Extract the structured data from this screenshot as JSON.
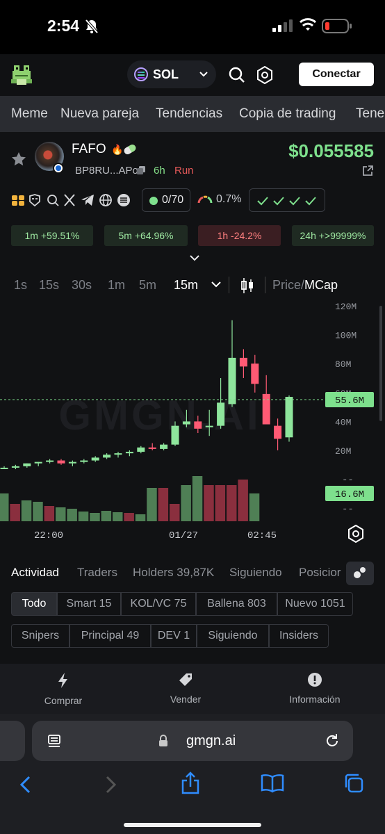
{
  "status": {
    "time": "2:54"
  },
  "header": {
    "chain": "SOL",
    "connect_label": "Conectar"
  },
  "nav_tabs": [
    "Meme",
    "Nueva pareja",
    "Tendencias",
    "Copia de trading",
    "Tene"
  ],
  "token": {
    "name": "FAFO",
    "address": "BP8RU...APo",
    "age": "6h",
    "run_label": "Run",
    "price": "$0.055585"
  },
  "metrics": {
    "holders_ratio": "0/70",
    "gauge_pct": "0.7%"
  },
  "changes": [
    {
      "period": "1m",
      "value": "+59.51%",
      "dir": "up"
    },
    {
      "period": "5m",
      "value": "+64.96%",
      "dir": "up"
    },
    {
      "period": "1h",
      "value": "-24.2%",
      "dir": "down"
    },
    {
      "period": "24h",
      "value": "+>99999%",
      "dir": "up"
    }
  ],
  "timeframes": [
    "1s",
    "15s",
    "30s",
    "1m",
    "5m",
    "15m"
  ],
  "active_timeframe": "15m",
  "price_label": "Price/",
  "mcap_label": "MCap",
  "chart_data": {
    "type": "candlestick",
    "watermark": "GMGN.AI",
    "y_ticks": [
      "120M",
      "100M",
      "80M",
      "60M",
      "40M",
      "20M"
    ],
    "x_ticks": [
      "22:00",
      "01/27",
      "02:45"
    ],
    "current_mcap": "55.6M",
    "current_volume": "16.6M",
    "candles": [
      {
        "o": 8,
        "h": 9,
        "l": 7,
        "c": 8
      },
      {
        "o": 8,
        "h": 10,
        "l": 7,
        "c": 9
      },
      {
        "o": 9,
        "h": 11,
        "l": 8,
        "c": 11
      },
      {
        "o": 11,
        "h": 12,
        "l": 9,
        "c": 12
      },
      {
        "o": 12,
        "h": 14,
        "l": 11,
        "c": 13
      },
      {
        "o": 13,
        "h": 14,
        "l": 10,
        "c": 11
      },
      {
        "o": 11,
        "h": 13,
        "l": 9,
        "c": 12
      },
      {
        "o": 12,
        "h": 14,
        "l": 11,
        "c": 13
      },
      {
        "o": 13,
        "h": 16,
        "l": 12,
        "c": 15
      },
      {
        "o": 15,
        "h": 18,
        "l": 14,
        "c": 17
      },
      {
        "o": 17,
        "h": 19,
        "l": 15,
        "c": 18
      },
      {
        "o": 18,
        "h": 20,
        "l": 16,
        "c": 19
      },
      {
        "o": 19,
        "h": 23,
        "l": 18,
        "c": 22
      },
      {
        "o": 22,
        "h": 25,
        "l": 20,
        "c": 21
      },
      {
        "o": 21,
        "h": 25,
        "l": 20,
        "c": 24
      },
      {
        "o": 24,
        "h": 40,
        "l": 23,
        "c": 37
      },
      {
        "o": 38,
        "h": 48,
        "l": 36,
        "c": 40
      },
      {
        "o": 40,
        "h": 44,
        "l": 32,
        "c": 35
      },
      {
        "o": 36,
        "h": 48,
        "l": 30,
        "c": 37
      },
      {
        "o": 37,
        "h": 70,
        "l": 35,
        "c": 53
      },
      {
        "o": 52,
        "h": 110,
        "l": 50,
        "c": 84
      },
      {
        "o": 84,
        "h": 90,
        "l": 70,
        "c": 78
      },
      {
        "o": 80,
        "h": 86,
        "l": 60,
        "c": 66
      },
      {
        "o": 59,
        "h": 72,
        "l": 48,
        "c": 38
      },
      {
        "o": 37,
        "h": 42,
        "l": 20,
        "c": 28
      },
      {
        "o": 29,
        "h": 58,
        "l": 26,
        "c": 57
      }
    ],
    "volumes": [
      {
        "v": 40,
        "dir": "up"
      },
      {
        "v": 25,
        "dir": "down"
      },
      {
        "v": 30,
        "dir": "up"
      },
      {
        "v": 28,
        "dir": "up"
      },
      {
        "v": 22,
        "dir": "down"
      },
      {
        "v": 20,
        "dir": "up"
      },
      {
        "v": 18,
        "dir": "up"
      },
      {
        "v": 14,
        "dir": "up"
      },
      {
        "v": 12,
        "dir": "up"
      },
      {
        "v": 15,
        "dir": "up"
      },
      {
        "v": 13,
        "dir": "up"
      },
      {
        "v": 12,
        "dir": "down"
      },
      {
        "v": 10,
        "dir": "up"
      },
      {
        "v": 48,
        "dir": "up"
      },
      {
        "v": 48,
        "dir": "down"
      },
      {
        "v": 25,
        "dir": "down"
      },
      {
        "v": 52,
        "dir": "up"
      },
      {
        "v": 65,
        "dir": "up"
      },
      {
        "v": 52,
        "dir": "down"
      },
      {
        "v": 52,
        "dir": "down"
      },
      {
        "v": 52,
        "dir": "down"
      },
      {
        "v": 60,
        "dir": "down"
      },
      {
        "v": 40,
        "dir": "up"
      }
    ]
  },
  "activity": {
    "tabs": [
      "Actividad",
      "Traders",
      "Holders 39,87K",
      "Siguiendo",
      "Posicior"
    ],
    "filters_row1": [
      "Todo",
      "Smart 15",
      "KOL/VC 75",
      "Ballena 803",
      "Nuevo 1051"
    ],
    "filters_row2": [
      "Snipers",
      "Principal 49",
      "DEV 1",
      "Siguiendo",
      "Insiders"
    ]
  },
  "bottom_actions": {
    "buy": "Comprar",
    "sell": "Vender",
    "info": "Información"
  },
  "browser": {
    "url": "gmgn.ai"
  }
}
